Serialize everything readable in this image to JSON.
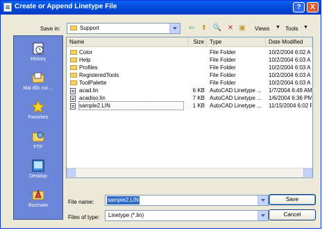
{
  "window": {
    "title": "Create or Append Linetype File",
    "help": "?",
    "close": "X"
  },
  "savein": {
    "label": "Save in:",
    "value": "Support"
  },
  "toolbar": {
    "views": "Views",
    "tools": "Tools"
  },
  "places": [
    {
      "name": "History"
    },
    {
      "name": "Mai đốc cui ..."
    },
    {
      "name": "Favorites"
    },
    {
      "name": "FTP"
    },
    {
      "name": "Desktop"
    },
    {
      "name": "Buzzsaw"
    }
  ],
  "columns": {
    "name": "Name",
    "size": "Size",
    "type": "Type",
    "date": "Date Modified"
  },
  "files": [
    {
      "name": "Color",
      "size": "",
      "type": "File Folder",
      "date": "10/2/2004 6:02 A",
      "kind": "folder"
    },
    {
      "name": "Help",
      "size": "",
      "type": "File Folder",
      "date": "10/2/2004 6:03 A",
      "kind": "folder"
    },
    {
      "name": "Profiles",
      "size": "",
      "type": "File Folder",
      "date": "10/2/2004 6:03 A",
      "kind": "folder"
    },
    {
      "name": "RegisteredTools",
      "size": "",
      "type": "File Folder",
      "date": "10/2/2004 6:03 A",
      "kind": "folder"
    },
    {
      "name": "ToolPalette",
      "size": "",
      "type": "File Folder",
      "date": "10/2/2004 6:03 A",
      "kind": "folder"
    },
    {
      "name": "acad.lin",
      "size": "6 KB",
      "type": "AutoCAD Linetype ...",
      "date": "1/7/2004 6:49 AM",
      "kind": "file"
    },
    {
      "name": "acadiso.lin",
      "size": "7 KB",
      "type": "AutoCAD Linetype ...",
      "date": "1/6/2004 6:36 PM",
      "kind": "file"
    },
    {
      "name": "sample2.LIN",
      "size": "1 KB",
      "type": "AutoCAD Linetype ...",
      "date": "11/15/2004 6:02 P",
      "kind": "file"
    }
  ],
  "filename": {
    "label": "File name:",
    "value": "sample2.LIN"
  },
  "filetype": {
    "label": "Files of type:",
    "value": "Linetype (*.lin)"
  },
  "buttons": {
    "save": "Save",
    "cancel": "Cancel"
  },
  "colors": {
    "title": "#0046d5",
    "places": "#6b86d8",
    "dialog": "#ece9d8",
    "selection": "#316ac5"
  }
}
